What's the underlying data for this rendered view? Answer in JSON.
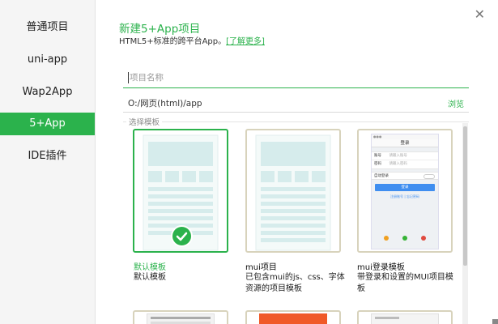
{
  "sidebar": {
    "items": [
      {
        "label": "普通项目"
      },
      {
        "label": "uni-app"
      },
      {
        "label": "Wap2App"
      },
      {
        "label": "5+App"
      },
      {
        "label": "IDE插件"
      }
    ]
  },
  "header": {
    "title": "新建5+App项目",
    "subtitle": "HTML5+标准的跨平台App。",
    "learn_more": "[了解更多]",
    "close": "✕"
  },
  "form": {
    "name_placeholder": "项目名称",
    "path_value": "O:/网页(html)/app",
    "browse_label": "浏览"
  },
  "templates": {
    "legend": "选择模板",
    "cards": [
      {
        "title": "默认模板",
        "desc": "默认模板"
      },
      {
        "title": "mui项目",
        "desc": "已包含mui的js、css、字体资源的项目模板"
      },
      {
        "title": "mui登录模板",
        "desc": "带登录和设置的MUI项目模板"
      }
    ],
    "login_preview": {
      "header": "登录",
      "account_label": "账号",
      "account_ph": "请输入账号",
      "password_label": "密码",
      "password_ph": "请输入密码",
      "autologin": "自动登录",
      "login_btn": "登录",
      "register": "注册账号",
      "forgot": "忘记密码"
    }
  },
  "colors": {
    "accent": "#2bb24c",
    "preview_block": "#d6ecec",
    "card_border": "#d8d3bc",
    "login_btn": "#3f8ef0"
  }
}
